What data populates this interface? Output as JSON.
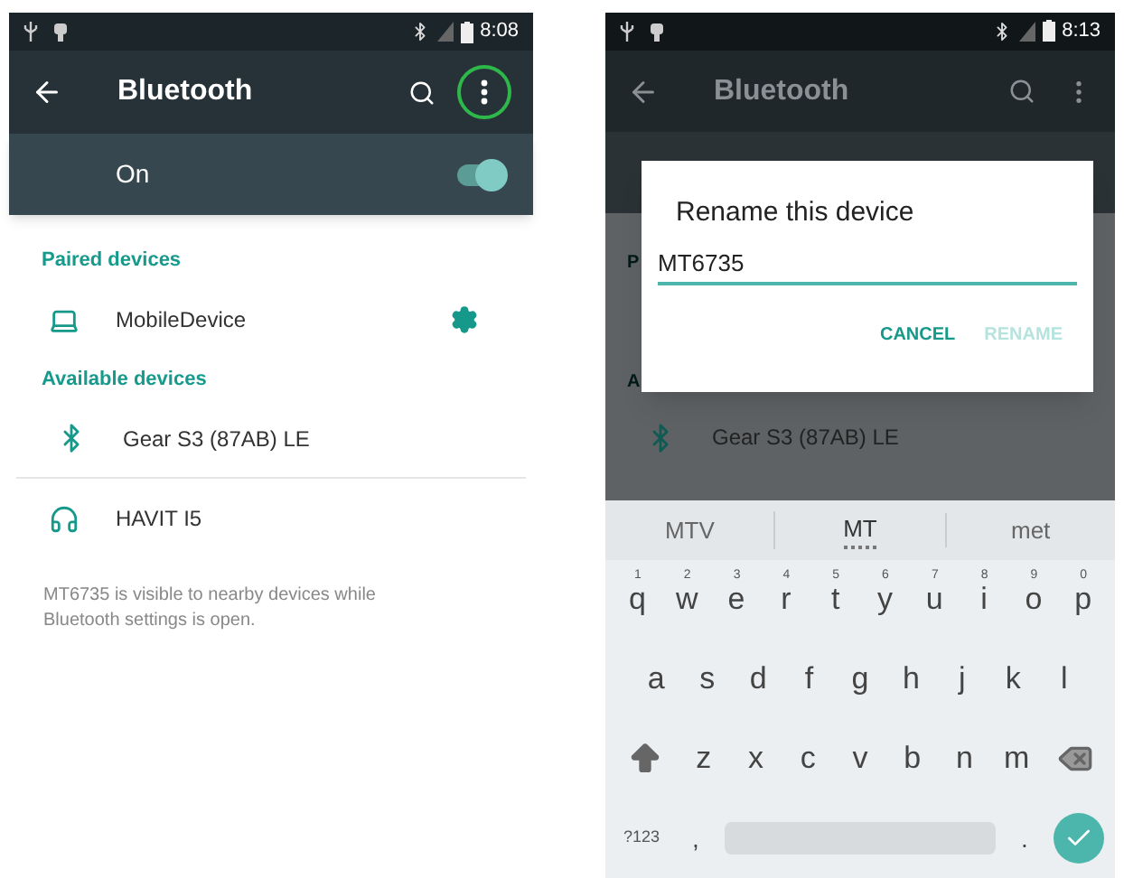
{
  "left": {
    "status_bar": {
      "time": "8:08"
    },
    "toolbar": {
      "title": "Bluetooth",
      "menu_highlighted": true
    },
    "toggle": {
      "label": "On",
      "on": true
    },
    "sections": [
      {
        "header": "Paired devices",
        "devices": [
          {
            "name": "MobileDevice",
            "kind": "laptop",
            "settings": true
          }
        ]
      },
      {
        "header": "Available devices",
        "devices": [
          {
            "name": "Gear S3 (87AB) LE",
            "kind": "bluetooth",
            "settings": false
          },
          {
            "name": "HAVIT I5",
            "kind": "headphones",
            "settings": false
          }
        ]
      }
    ],
    "note": "MT6735 is visible to nearby devices while Bluetooth settings is open."
  },
  "right": {
    "status_bar": {
      "time": "8:13"
    },
    "toolbar": {
      "title": "Bluetooth"
    },
    "background_fragments": [
      "P",
      "A"
    ],
    "background_device": {
      "name": "Gear S3 (87AB) LE",
      "kind": "bluetooth"
    },
    "dialog": {
      "title": "Rename this device",
      "value": "MT6735",
      "buttons": [
        {
          "label": "CANCEL",
          "disabled": false
        },
        {
          "label": "RENAME",
          "disabled": true
        }
      ]
    },
    "keyboard": {
      "suggestions": [
        {
          "text": "MTV",
          "selected": false
        },
        {
          "text": "MT",
          "selected": true
        },
        {
          "text": "met",
          "selected": false
        }
      ],
      "rows": [
        [
          {
            "key": "q",
            "hint": "1"
          },
          {
            "key": "w",
            "hint": "2"
          },
          {
            "key": "e",
            "hint": "3"
          },
          {
            "key": "r",
            "hint": "4"
          },
          {
            "key": "t",
            "hint": "5"
          },
          {
            "key": "y",
            "hint": "6"
          },
          {
            "key": "u",
            "hint": "7"
          },
          {
            "key": "i",
            "hint": "8"
          },
          {
            "key": "o",
            "hint": "9"
          },
          {
            "key": "p",
            "hint": "0"
          }
        ],
        [
          {
            "key": "a"
          },
          {
            "key": "s"
          },
          {
            "key": "d"
          },
          {
            "key": "f"
          },
          {
            "key": "g"
          },
          {
            "key": "h"
          },
          {
            "key": "j"
          },
          {
            "key": "k"
          },
          {
            "key": "l"
          }
        ],
        [
          {
            "key": "z"
          },
          {
            "key": "x"
          },
          {
            "key": "c"
          },
          {
            "key": "v"
          },
          {
            "key": "b"
          },
          {
            "key": "n"
          },
          {
            "key": "m"
          }
        ]
      ],
      "symbols_key": "?123",
      "comma_key": ",",
      "period_key": "."
    }
  }
}
